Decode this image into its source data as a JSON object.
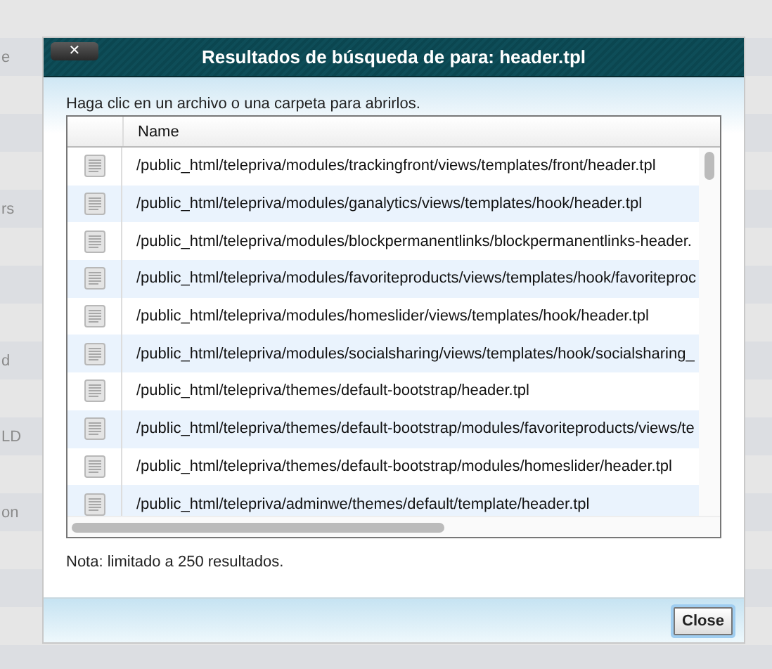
{
  "background_rows": [
    {},
    {
      "text": "e"
    },
    {},
    {},
    {},
    {
      "text": "rs"
    },
    {},
    {},
    {},
    {
      "text": "d"
    },
    {},
    {
      "text": "LD"
    },
    {},
    {
      "text": "on"
    },
    {},
    {},
    {},
    {}
  ],
  "dialog": {
    "title": "Resultados de búsqueda de para: header.tpl",
    "close_icon": "✕",
    "instruction": "Haga clic en un archivo o una carpeta para abrirlos.",
    "table": {
      "columns": [
        "Name"
      ],
      "rows": [
        {
          "path": "/public_html/telepriva/modules/trackingfront/views/templates/front/header.tpl"
        },
        {
          "path": "/public_html/telepriva/modules/ganalytics/views/templates/hook/header.tpl"
        },
        {
          "path": "/public_html/telepriva/modules/blockpermanentlinks/blockpermanentlinks-header."
        },
        {
          "path": "/public_html/telepriva/modules/favoriteproducts/views/templates/hook/favoriteproc"
        },
        {
          "path": "/public_html/telepriva/modules/homeslider/views/templates/hook/header.tpl"
        },
        {
          "path": "/public_html/telepriva/modules/socialsharing/views/templates/hook/socialsharing_"
        },
        {
          "path": "/public_html/telepriva/themes/default-bootstrap/header.tpl"
        },
        {
          "path": "/public_html/telepriva/themes/default-bootstrap/modules/favoriteproducts/views/te"
        },
        {
          "path": "/public_html/telepriva/themes/default-bootstrap/modules/homeslider/header.tpl"
        },
        {
          "path": "/public_html/telepriva/adminwe/themes/default/template/header.tpl"
        }
      ]
    },
    "note": "Nota: limitado a 250 resultados.",
    "buttons": [
      "Close"
    ]
  }
}
